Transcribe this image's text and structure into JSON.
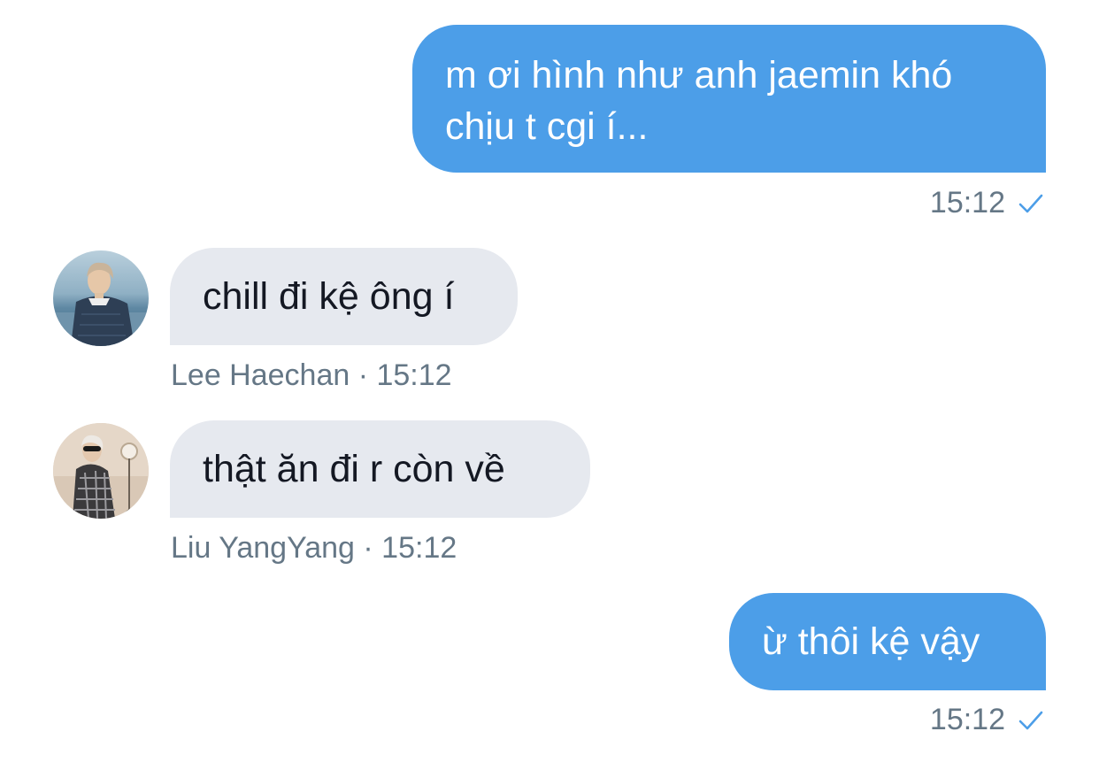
{
  "conversation": {
    "messages": [
      {
        "direction": "sent",
        "text": "m ơi hình như anh jaemin khó chịu t cgi í...",
        "time": "15:12",
        "status": "read-check-icon"
      },
      {
        "direction": "received",
        "text": "chill đi kệ ông í",
        "sender_meta": "Lee Haechan · 15:12",
        "avatar": "photo-avatar-beach"
      },
      {
        "direction": "received",
        "text": "thật ăn đi r còn về",
        "sender_meta": "Liu YangYang · 15:12",
        "avatar": "photo-avatar-studio"
      },
      {
        "direction": "sent",
        "text": "ừ thôi kệ vậy",
        "time": "15:12",
        "status": "read-check-icon"
      }
    ]
  },
  "colors": {
    "sent_bubble": "#4c9ee8",
    "received_bubble": "#e6e9ef",
    "meta_text": "#657786",
    "check": "#4c9ee8"
  }
}
